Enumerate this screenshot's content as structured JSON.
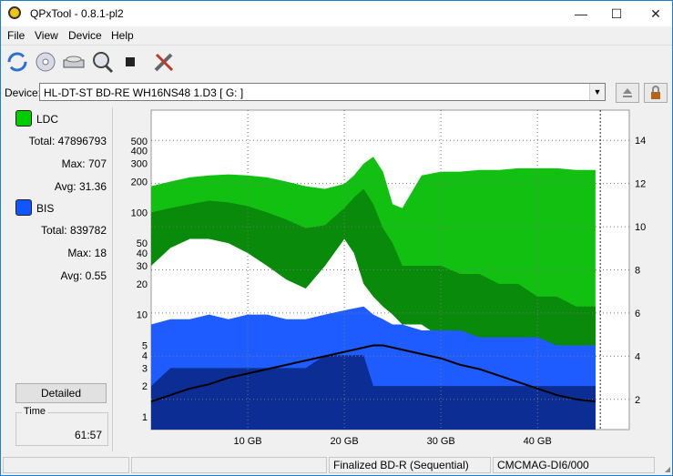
{
  "window": {
    "title": "QPxTool - 0.8.1-pl2"
  },
  "menu": [
    "File",
    "View",
    "Device",
    "Help"
  ],
  "toolbar": {
    "icons": [
      "refresh-icon",
      "disc-icon",
      "drive-icon",
      "magnifier-icon",
      "stop-icon",
      "tools-icon"
    ]
  },
  "device": {
    "label": "Device:",
    "value": "HL-DT-ST BD-RE  WH16NS48  1.D3 [ G: ]"
  },
  "legend": {
    "ldc": {
      "name": "LDC",
      "color": "#00cc00",
      "total": "Total: 47896793",
      "max": "Max: 707",
      "avg": "Avg: 31.36"
    },
    "bis": {
      "name": "BIS",
      "color": "#1155ff",
      "total": "Total: 839782",
      "max": "Max: 18",
      "avg": "Avg: 0.55"
    }
  },
  "detailed_button": "Detailed",
  "time": {
    "label": "Time",
    "value": "61:57"
  },
  "status": {
    "disc_type": "Finalized BD-R (Sequential)",
    "media_id": "CMCMAG-DI6/000"
  },
  "chart_data": {
    "type": "area",
    "x_tick_labels": [
      "10 GB",
      "20 GB",
      "30 GB",
      "40 GB"
    ],
    "x_ticks": [
      10,
      20,
      30,
      40
    ],
    "xlim": [
      0,
      49.5
    ],
    "disc_end": 46.5,
    "y_left_scale": "log",
    "y_left_ticks": [
      1,
      2,
      3,
      4,
      5,
      10,
      20,
      30,
      40,
      50,
      100,
      200,
      300,
      400,
      500
    ],
    "y_left_lim": [
      0.75,
      1000
    ],
    "y_right_ticks": [
      2,
      4,
      6,
      8,
      10,
      12,
      14
    ],
    "y_right_lim": [
      0.6,
      15.4
    ],
    "grid": true,
    "series": [
      {
        "name": "LDC",
        "color": "#00cc00",
        "x": [
          0,
          2,
          4,
          6,
          8,
          10,
          12,
          14,
          16,
          18,
          20,
          21,
          22,
          23,
          24,
          25,
          26,
          28,
          30,
          32,
          34,
          36,
          38,
          40,
          42,
          44,
          46
        ],
        "max": [
          180,
          200,
          220,
          230,
          235,
          230,
          220,
          200,
          180,
          170,
          190,
          230,
          300,
          350,
          250,
          120,
          110,
          230,
          250,
          250,
          260,
          260,
          270,
          270,
          270,
          260,
          260
        ],
        "avg": [
          100,
          110,
          120,
          130,
          125,
          115,
          100,
          85,
          70,
          75,
          110,
          140,
          170,
          120,
          70,
          50,
          30,
          30,
          30,
          25,
          25,
          20,
          20,
          15,
          15,
          12,
          12
        ],
        "min": [
          30,
          45,
          55,
          55,
          50,
          40,
          30,
          22,
          18,
          30,
          55,
          40,
          20,
          15,
          12,
          10,
          8,
          8,
          6,
          5,
          4,
          3,
          2,
          2,
          2,
          1.5,
          1.5
        ]
      },
      {
        "name": "BIS",
        "color": "#1155ff",
        "x": [
          0,
          2,
          4,
          6,
          8,
          10,
          12,
          14,
          16,
          18,
          20,
          22,
          23,
          24,
          25,
          26,
          28,
          30,
          32,
          34,
          36,
          38,
          40,
          42,
          44,
          46
        ],
        "max": [
          8,
          9,
          9,
          10,
          9,
          10,
          10,
          9,
          9,
          10,
          11,
          12,
          10,
          9,
          8,
          8,
          7,
          7,
          7,
          6,
          6,
          6,
          6,
          5,
          5,
          5
        ],
        "avg": [
          2,
          3,
          3,
          3,
          3,
          3,
          3,
          3,
          3,
          4,
          4,
          4,
          2,
          2,
          2,
          2,
          2,
          2,
          2,
          2,
          2,
          2,
          2,
          2,
          2,
          2
        ]
      },
      {
        "name": "Speed",
        "x": [
          0,
          2,
          4,
          6,
          8,
          10,
          12,
          14,
          16,
          18,
          20,
          22,
          23,
          24,
          26,
          28,
          30,
          32,
          34,
          36,
          38,
          40,
          42,
          44,
          46
        ],
        "y": [
          1.9,
          2.2,
          2.5,
          2.7,
          3.0,
          3.2,
          3.4,
          3.6,
          3.8,
          4.0,
          4.2,
          4.4,
          4.5,
          4.5,
          4.3,
          4.1,
          3.9,
          3.6,
          3.4,
          3.1,
          2.8,
          2.5,
          2.2,
          2.0,
          1.9
        ]
      }
    ]
  }
}
